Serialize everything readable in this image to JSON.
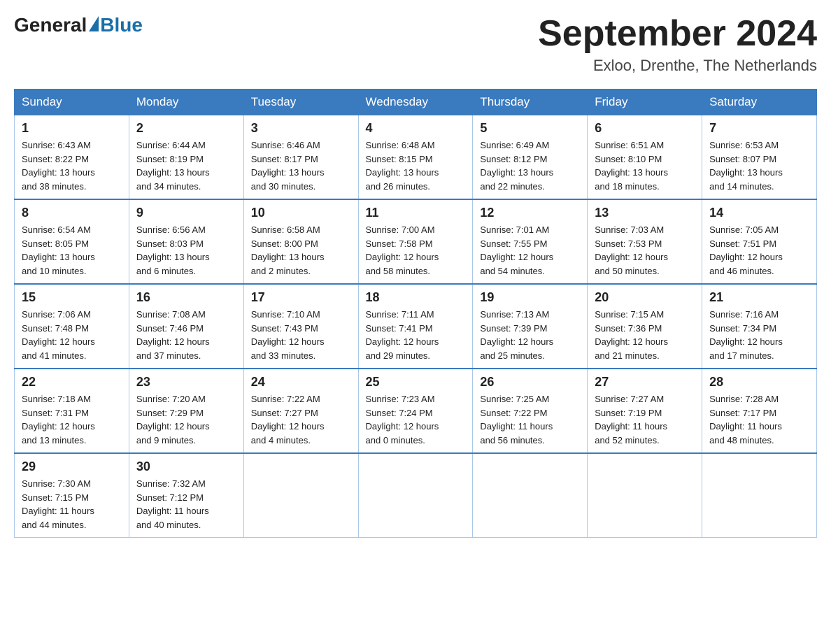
{
  "header": {
    "logo_general": "General",
    "logo_blue": "Blue",
    "month_year": "September 2024",
    "location": "Exloo, Drenthe, The Netherlands"
  },
  "days_of_week": [
    "Sunday",
    "Monday",
    "Tuesday",
    "Wednesday",
    "Thursday",
    "Friday",
    "Saturday"
  ],
  "weeks": [
    [
      {
        "day": "1",
        "sunrise": "6:43 AM",
        "sunset": "8:22 PM",
        "daylight": "13 hours and 38 minutes."
      },
      {
        "day": "2",
        "sunrise": "6:44 AM",
        "sunset": "8:19 PM",
        "daylight": "13 hours and 34 minutes."
      },
      {
        "day": "3",
        "sunrise": "6:46 AM",
        "sunset": "8:17 PM",
        "daylight": "13 hours and 30 minutes."
      },
      {
        "day": "4",
        "sunrise": "6:48 AM",
        "sunset": "8:15 PM",
        "daylight": "13 hours and 26 minutes."
      },
      {
        "day": "5",
        "sunrise": "6:49 AM",
        "sunset": "8:12 PM",
        "daylight": "13 hours and 22 minutes."
      },
      {
        "day": "6",
        "sunrise": "6:51 AM",
        "sunset": "8:10 PM",
        "daylight": "13 hours and 18 minutes."
      },
      {
        "day": "7",
        "sunrise": "6:53 AM",
        "sunset": "8:07 PM",
        "daylight": "13 hours and 14 minutes."
      }
    ],
    [
      {
        "day": "8",
        "sunrise": "6:54 AM",
        "sunset": "8:05 PM",
        "daylight": "13 hours and 10 minutes."
      },
      {
        "day": "9",
        "sunrise": "6:56 AM",
        "sunset": "8:03 PM",
        "daylight": "13 hours and 6 minutes."
      },
      {
        "day": "10",
        "sunrise": "6:58 AM",
        "sunset": "8:00 PM",
        "daylight": "13 hours and 2 minutes."
      },
      {
        "day": "11",
        "sunrise": "7:00 AM",
        "sunset": "7:58 PM",
        "daylight": "12 hours and 58 minutes."
      },
      {
        "day": "12",
        "sunrise": "7:01 AM",
        "sunset": "7:55 PM",
        "daylight": "12 hours and 54 minutes."
      },
      {
        "day": "13",
        "sunrise": "7:03 AM",
        "sunset": "7:53 PM",
        "daylight": "12 hours and 50 minutes."
      },
      {
        "day": "14",
        "sunrise": "7:05 AM",
        "sunset": "7:51 PM",
        "daylight": "12 hours and 46 minutes."
      }
    ],
    [
      {
        "day": "15",
        "sunrise": "7:06 AM",
        "sunset": "7:48 PM",
        "daylight": "12 hours and 41 minutes."
      },
      {
        "day": "16",
        "sunrise": "7:08 AM",
        "sunset": "7:46 PM",
        "daylight": "12 hours and 37 minutes."
      },
      {
        "day": "17",
        "sunrise": "7:10 AM",
        "sunset": "7:43 PM",
        "daylight": "12 hours and 33 minutes."
      },
      {
        "day": "18",
        "sunrise": "7:11 AM",
        "sunset": "7:41 PM",
        "daylight": "12 hours and 29 minutes."
      },
      {
        "day": "19",
        "sunrise": "7:13 AM",
        "sunset": "7:39 PM",
        "daylight": "12 hours and 25 minutes."
      },
      {
        "day": "20",
        "sunrise": "7:15 AM",
        "sunset": "7:36 PM",
        "daylight": "12 hours and 21 minutes."
      },
      {
        "day": "21",
        "sunrise": "7:16 AM",
        "sunset": "7:34 PM",
        "daylight": "12 hours and 17 minutes."
      }
    ],
    [
      {
        "day": "22",
        "sunrise": "7:18 AM",
        "sunset": "7:31 PM",
        "daylight": "12 hours and 13 minutes."
      },
      {
        "day": "23",
        "sunrise": "7:20 AM",
        "sunset": "7:29 PM",
        "daylight": "12 hours and 9 minutes."
      },
      {
        "day": "24",
        "sunrise": "7:22 AM",
        "sunset": "7:27 PM",
        "daylight": "12 hours and 4 minutes."
      },
      {
        "day": "25",
        "sunrise": "7:23 AM",
        "sunset": "7:24 PM",
        "daylight": "12 hours and 0 minutes."
      },
      {
        "day": "26",
        "sunrise": "7:25 AM",
        "sunset": "7:22 PM",
        "daylight": "11 hours and 56 minutes."
      },
      {
        "day": "27",
        "sunrise": "7:27 AM",
        "sunset": "7:19 PM",
        "daylight": "11 hours and 52 minutes."
      },
      {
        "day": "28",
        "sunrise": "7:28 AM",
        "sunset": "7:17 PM",
        "daylight": "11 hours and 48 minutes."
      }
    ],
    [
      {
        "day": "29",
        "sunrise": "7:30 AM",
        "sunset": "7:15 PM",
        "daylight": "11 hours and 44 minutes."
      },
      {
        "day": "30",
        "sunrise": "7:32 AM",
        "sunset": "7:12 PM",
        "daylight": "11 hours and 40 minutes."
      },
      null,
      null,
      null,
      null,
      null
    ]
  ],
  "labels": {
    "sunrise": "Sunrise:",
    "sunset": "Sunset:",
    "daylight": "Daylight:"
  }
}
